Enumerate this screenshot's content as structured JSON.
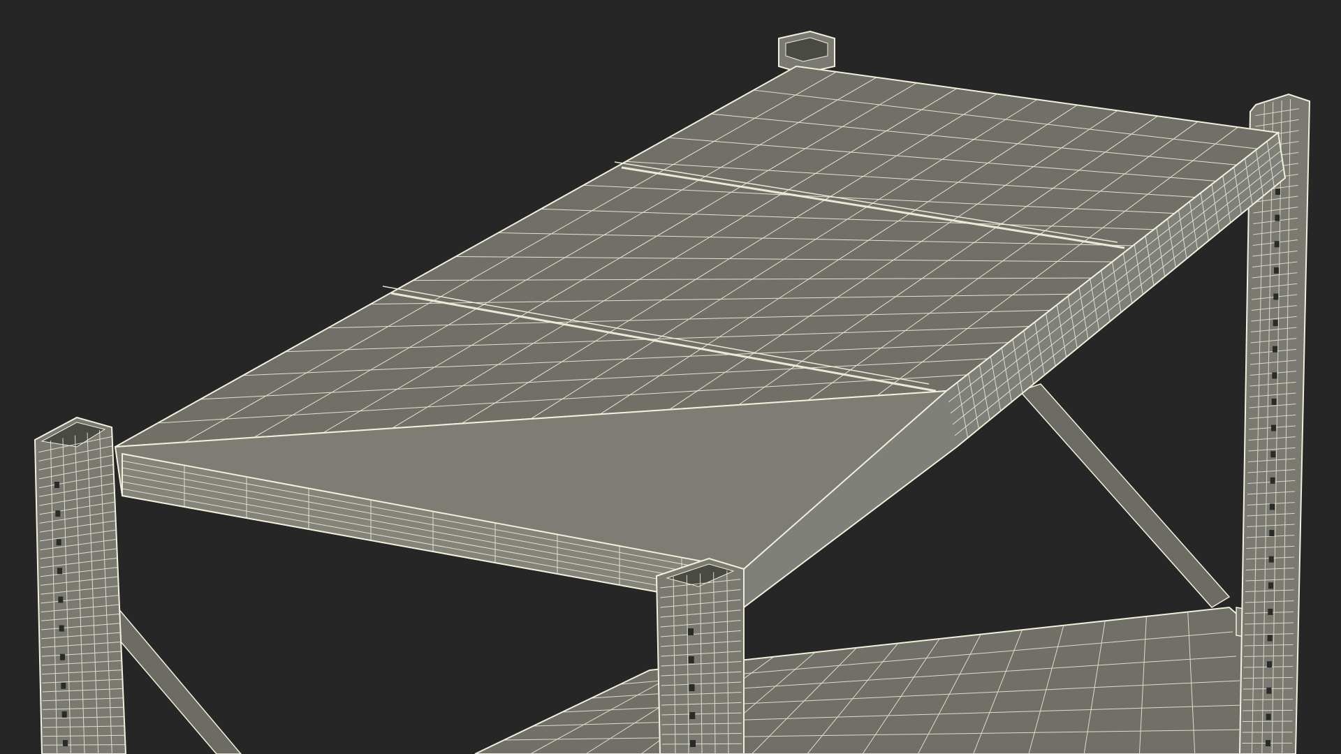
{
  "scene": {
    "subject": "wireframe-metal-shelving-unit",
    "colors": {
      "background": "#262626",
      "surface": "#707068",
      "surface_dark": "#5f5f58",
      "frame": "#7a7a72",
      "wire": "#f2f0dc",
      "hole": "#2a2a28"
    }
  }
}
